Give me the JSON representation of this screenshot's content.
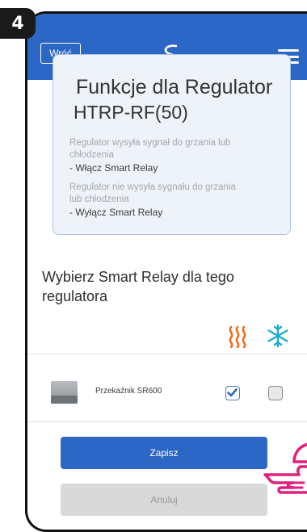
{
  "step": "4",
  "header": {
    "back_label": "Wróć"
  },
  "info": {
    "title_line1": "Funkcje dla Regulator",
    "title_line2": "HTRP-RF(50)",
    "text1_line1": "Regulator wysyła sygnał do grzania lub",
    "text1_line2": "chłodzenia",
    "bullet1": "- Włącz Smart Relay",
    "text2_line1": "Regulator nie wysyła sygnału do grzania",
    "text2_line2": "lub chłodzenia",
    "bullet2": "- Wyłącz Smart Relay"
  },
  "select": {
    "title": "Wybierz Smart Relay dla tego regulatora"
  },
  "relay": {
    "name": "Przekaźnik SR600",
    "heating_checked": true,
    "cooling_checked": false
  },
  "actions": {
    "save": "Zapisz",
    "cancel": "Anuluj"
  },
  "colors": {
    "primary": "#2c67c5",
    "heat": "#f26a1b",
    "cool": "#1aa9d6",
    "pointer": "#e0207a"
  }
}
